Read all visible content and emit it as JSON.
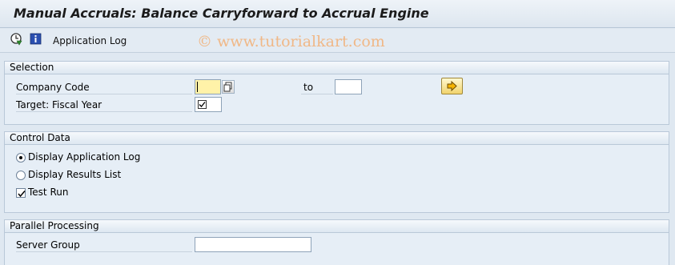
{
  "window": {
    "title": "Manual Accruals: Balance Carryforward to Accrual Engine"
  },
  "toolbar": {
    "execute_icon": "execute-clock-icon",
    "info_icon": "information-icon",
    "app_log_label": "Application Log",
    "watermark": "© www.tutorialkart.com"
  },
  "selection": {
    "title": "Selection",
    "company_code": {
      "label": "Company Code",
      "value": "",
      "to_label": "to",
      "to_value": ""
    },
    "fiscal_year": {
      "label": "Target: Fiscal Year",
      "value": ""
    }
  },
  "control_data": {
    "title": "Control Data",
    "options": [
      {
        "label": "Display Application Log",
        "selected": true
      },
      {
        "label": "Display Results List",
        "selected": false
      }
    ],
    "test_run": {
      "label": "Test Run",
      "checked": true
    }
  },
  "parallel": {
    "title": "Parallel Processing",
    "server_group": {
      "label": "Server Group",
      "value": ""
    }
  },
  "colors": {
    "background": "#dfe8f1",
    "required_field": "#fff2a8",
    "watermark": "#f0b887"
  }
}
